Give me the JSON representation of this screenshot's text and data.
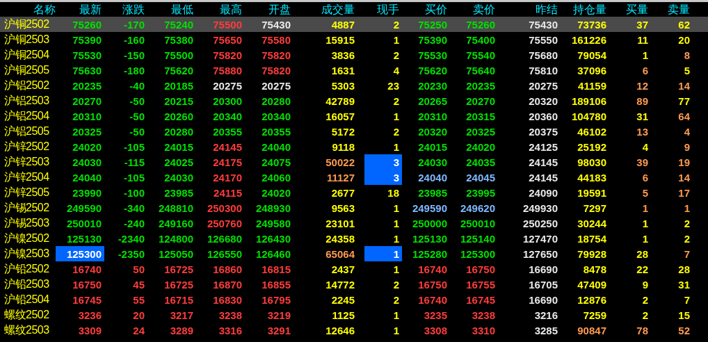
{
  "columns": [
    "名称",
    "最新",
    "涨跌",
    "最低",
    "最高",
    "开盘",
    "成交量",
    "现手",
    "买价",
    "卖价",
    "昨结",
    "持仓量",
    "买量",
    "卖量"
  ],
  "rows": [
    {
      "name": "沪铜2502",
      "selected": true,
      "cells": [
        {
          "text": "75260",
          "color": "#00e000",
          "flash": false
        },
        {
          "text": "-170",
          "color": "#00e000",
          "flash": false
        },
        {
          "text": "75240",
          "color": "#00e000",
          "flash": false
        },
        {
          "text": "75500",
          "color": "#ff3c3c",
          "flash": false
        },
        {
          "text": "75430",
          "color": "#e8e8e8",
          "flash": false
        },
        {
          "text": "4887",
          "color": "#ffff00",
          "flash": false
        },
        {
          "text": "2",
          "color": "#ffff00",
          "flash": false
        },
        {
          "text": "75250",
          "color": "#00e000",
          "flash": false
        },
        {
          "text": "75260",
          "color": "#00e000",
          "flash": false
        },
        {
          "text": "75430",
          "color": "#e8e8e8",
          "flash": false
        },
        {
          "text": "73736",
          "color": "#ffff00",
          "flash": false
        },
        {
          "text": "37",
          "color": "#ffff00",
          "flash": false
        },
        {
          "text": "62",
          "color": "#ffff00",
          "flash": false
        }
      ]
    },
    {
      "name": "沪铜2503",
      "selected": false,
      "cells": [
        {
          "text": "75390",
          "color": "#00e000",
          "flash": false
        },
        {
          "text": "-160",
          "color": "#00e000",
          "flash": false
        },
        {
          "text": "75380",
          "color": "#00e000",
          "flash": false
        },
        {
          "text": "75650",
          "color": "#ff3c3c",
          "flash": false
        },
        {
          "text": "75580",
          "color": "#ff3c3c",
          "flash": false
        },
        {
          "text": "15915",
          "color": "#ffff00",
          "flash": false
        },
        {
          "text": "1",
          "color": "#ffff00",
          "flash": false
        },
        {
          "text": "75390",
          "color": "#00e000",
          "flash": false
        },
        {
          "text": "75400",
          "color": "#00e000",
          "flash": false
        },
        {
          "text": "75550",
          "color": "#e8e8e8",
          "flash": false
        },
        {
          "text": "161226",
          "color": "#ffff00",
          "flash": false
        },
        {
          "text": "11",
          "color": "#ffff00",
          "flash": false
        },
        {
          "text": "20",
          "color": "#ffff00",
          "flash": false
        }
      ]
    },
    {
      "name": "沪铜2504",
      "selected": false,
      "cells": [
        {
          "text": "75530",
          "color": "#00e000",
          "flash": false
        },
        {
          "text": "-150",
          "color": "#00e000",
          "flash": false
        },
        {
          "text": "75500",
          "color": "#00e000",
          "flash": false
        },
        {
          "text": "75820",
          "color": "#ff3c3c",
          "flash": false
        },
        {
          "text": "75820",
          "color": "#ff3c3c",
          "flash": false
        },
        {
          "text": "3836",
          "color": "#ffff00",
          "flash": false
        },
        {
          "text": "2",
          "color": "#ffff00",
          "flash": false
        },
        {
          "text": "75530",
          "color": "#00e000",
          "flash": false
        },
        {
          "text": "75540",
          "color": "#00e000",
          "flash": false
        },
        {
          "text": "75680",
          "color": "#e8e8e8",
          "flash": false
        },
        {
          "text": "79054",
          "color": "#ffff00",
          "flash": false
        },
        {
          "text": "1",
          "color": "#ffff00",
          "flash": false
        },
        {
          "text": "8",
          "color": "#ff9a50",
          "flash": false
        }
      ]
    },
    {
      "name": "沪铜2505",
      "selected": false,
      "cells": [
        {
          "text": "75630",
          "color": "#00e000",
          "flash": false
        },
        {
          "text": "-180",
          "color": "#00e000",
          "flash": false
        },
        {
          "text": "75620",
          "color": "#00e000",
          "flash": false
        },
        {
          "text": "75880",
          "color": "#ff3c3c",
          "flash": false
        },
        {
          "text": "75820",
          "color": "#ff3c3c",
          "flash": false
        },
        {
          "text": "1631",
          "color": "#ffff00",
          "flash": false
        },
        {
          "text": "4",
          "color": "#ffff00",
          "flash": false
        },
        {
          "text": "75620",
          "color": "#00e000",
          "flash": false
        },
        {
          "text": "75640",
          "color": "#00e000",
          "flash": false
        },
        {
          "text": "75810",
          "color": "#e8e8e8",
          "flash": false
        },
        {
          "text": "37096",
          "color": "#ffff00",
          "flash": false
        },
        {
          "text": "6",
          "color": "#ff9a50",
          "flash": false
        },
        {
          "text": "5",
          "color": "#ffff00",
          "flash": false
        }
      ]
    },
    {
      "name": "沪铝2502",
      "selected": false,
      "cells": [
        {
          "text": "20235",
          "color": "#00e000",
          "flash": false
        },
        {
          "text": "-40",
          "color": "#00e000",
          "flash": false
        },
        {
          "text": "20185",
          "color": "#00e000",
          "flash": false
        },
        {
          "text": "20275",
          "color": "#e8e8e8",
          "flash": false
        },
        {
          "text": "20275",
          "color": "#e8e8e8",
          "flash": false
        },
        {
          "text": "5303",
          "color": "#ffff00",
          "flash": false
        },
        {
          "text": "23",
          "color": "#ffff00",
          "flash": false
        },
        {
          "text": "20230",
          "color": "#00e000",
          "flash": false
        },
        {
          "text": "20235",
          "color": "#00e000",
          "flash": false
        },
        {
          "text": "20275",
          "color": "#e8e8e8",
          "flash": false
        },
        {
          "text": "41159",
          "color": "#ffff00",
          "flash": false
        },
        {
          "text": "12",
          "color": "#ff9a50",
          "flash": false
        },
        {
          "text": "14",
          "color": "#ff9a50",
          "flash": false
        }
      ]
    },
    {
      "name": "沪铝2503",
      "selected": false,
      "cells": [
        {
          "text": "20270",
          "color": "#00e000",
          "flash": false
        },
        {
          "text": "-50",
          "color": "#00e000",
          "flash": false
        },
        {
          "text": "20215",
          "color": "#00e000",
          "flash": false
        },
        {
          "text": "20300",
          "color": "#00e000",
          "flash": false
        },
        {
          "text": "20280",
          "color": "#00e000",
          "flash": false
        },
        {
          "text": "42789",
          "color": "#ffff00",
          "flash": false
        },
        {
          "text": "2",
          "color": "#ffff00",
          "flash": false
        },
        {
          "text": "20265",
          "color": "#00e000",
          "flash": false
        },
        {
          "text": "20270",
          "color": "#00e000",
          "flash": false
        },
        {
          "text": "20320",
          "color": "#e8e8e8",
          "flash": false
        },
        {
          "text": "189106",
          "color": "#ffff00",
          "flash": false
        },
        {
          "text": "89",
          "color": "#ff9a50",
          "flash": false
        },
        {
          "text": "77",
          "color": "#ffff00",
          "flash": false
        }
      ]
    },
    {
      "name": "沪铝2504",
      "selected": false,
      "cells": [
        {
          "text": "20310",
          "color": "#00e000",
          "flash": false
        },
        {
          "text": "-50",
          "color": "#00e000",
          "flash": false
        },
        {
          "text": "20260",
          "color": "#00e000",
          "flash": false
        },
        {
          "text": "20340",
          "color": "#00e000",
          "flash": false
        },
        {
          "text": "20340",
          "color": "#00e000",
          "flash": false
        },
        {
          "text": "16057",
          "color": "#ffff00",
          "flash": false
        },
        {
          "text": "1",
          "color": "#ffff00",
          "flash": false
        },
        {
          "text": "20310",
          "color": "#00e000",
          "flash": false
        },
        {
          "text": "20315",
          "color": "#00e000",
          "flash": false
        },
        {
          "text": "20360",
          "color": "#e8e8e8",
          "flash": false
        },
        {
          "text": "104780",
          "color": "#ffff00",
          "flash": false
        },
        {
          "text": "31",
          "color": "#ffff00",
          "flash": false
        },
        {
          "text": "64",
          "color": "#ff9a50",
          "flash": false
        }
      ]
    },
    {
      "name": "沪铝2505",
      "selected": false,
      "cells": [
        {
          "text": "20325",
          "color": "#00e000",
          "flash": false
        },
        {
          "text": "-50",
          "color": "#00e000",
          "flash": false
        },
        {
          "text": "20280",
          "color": "#00e000",
          "flash": false
        },
        {
          "text": "20355",
          "color": "#00e000",
          "flash": false
        },
        {
          "text": "20355",
          "color": "#00e000",
          "flash": false
        },
        {
          "text": "5172",
          "color": "#ffff00",
          "flash": false
        },
        {
          "text": "2",
          "color": "#ffff00",
          "flash": false
        },
        {
          "text": "20320",
          "color": "#00e000",
          "flash": false
        },
        {
          "text": "20325",
          "color": "#00e000",
          "flash": false
        },
        {
          "text": "20375",
          "color": "#e8e8e8",
          "flash": false
        },
        {
          "text": "46102",
          "color": "#ffff00",
          "flash": false
        },
        {
          "text": "13",
          "color": "#ff9a50",
          "flash": false
        },
        {
          "text": "4",
          "color": "#ff9a50",
          "flash": false
        }
      ]
    },
    {
      "name": "沪锌2502",
      "selected": false,
      "cells": [
        {
          "text": "24020",
          "color": "#00e000",
          "flash": false
        },
        {
          "text": "-105",
          "color": "#00e000",
          "flash": false
        },
        {
          "text": "24015",
          "color": "#00e000",
          "flash": false
        },
        {
          "text": "24145",
          "color": "#ff3c3c",
          "flash": false
        },
        {
          "text": "24040",
          "color": "#00e000",
          "flash": false
        },
        {
          "text": "9118",
          "color": "#ffff00",
          "flash": false
        },
        {
          "text": "1",
          "color": "#ffff00",
          "flash": false
        },
        {
          "text": "24015",
          "color": "#00e000",
          "flash": false
        },
        {
          "text": "24020",
          "color": "#00e000",
          "flash": false
        },
        {
          "text": "24125",
          "color": "#e8e8e8",
          "flash": false
        },
        {
          "text": "25192",
          "color": "#ffff00",
          "flash": false
        },
        {
          "text": "4",
          "color": "#ffff00",
          "flash": false
        },
        {
          "text": "9",
          "color": "#ff9a50",
          "flash": false
        }
      ]
    },
    {
      "name": "沪锌2503",
      "selected": false,
      "cells": [
        {
          "text": "24030",
          "color": "#00e000",
          "flash": false
        },
        {
          "text": "-115",
          "color": "#00e000",
          "flash": false
        },
        {
          "text": "24025",
          "color": "#00e000",
          "flash": false
        },
        {
          "text": "24175",
          "color": "#ff3c3c",
          "flash": false
        },
        {
          "text": "24075",
          "color": "#00e000",
          "flash": false
        },
        {
          "text": "50022",
          "color": "#ff9a50",
          "flash": false
        },
        {
          "text": "3",
          "color": "#ffffff",
          "flash": true
        },
        {
          "text": "24030",
          "color": "#00e000",
          "flash": false
        },
        {
          "text": "24035",
          "color": "#00e000",
          "flash": false
        },
        {
          "text": "24145",
          "color": "#e8e8e8",
          "flash": false
        },
        {
          "text": "98030",
          "color": "#ffff00",
          "flash": false
        },
        {
          "text": "39",
          "color": "#ff9a50",
          "flash": false
        },
        {
          "text": "19",
          "color": "#ff9a50",
          "flash": false
        }
      ]
    },
    {
      "name": "沪锌2504",
      "selected": false,
      "cells": [
        {
          "text": "24040",
          "color": "#00e000",
          "flash": false
        },
        {
          "text": "-105",
          "color": "#00e000",
          "flash": false
        },
        {
          "text": "24030",
          "color": "#00e000",
          "flash": false
        },
        {
          "text": "24170",
          "color": "#ff3c3c",
          "flash": false
        },
        {
          "text": "24060",
          "color": "#00e000",
          "flash": false
        },
        {
          "text": "11127",
          "color": "#ff9a50",
          "flash": false
        },
        {
          "text": "3",
          "color": "#ffffff",
          "flash": true
        },
        {
          "text": "24040",
          "color": "#80b8ff",
          "flash": false
        },
        {
          "text": "24045",
          "color": "#80b8ff",
          "flash": false
        },
        {
          "text": "24145",
          "color": "#e8e8e8",
          "flash": false
        },
        {
          "text": "44183",
          "color": "#ffff00",
          "flash": false
        },
        {
          "text": "6",
          "color": "#ff9a50",
          "flash": false
        },
        {
          "text": "14",
          "color": "#ff9a50",
          "flash": false
        }
      ]
    },
    {
      "name": "沪锌2505",
      "selected": false,
      "cells": [
        {
          "text": "23990",
          "color": "#00e000",
          "flash": false
        },
        {
          "text": "-100",
          "color": "#00e000",
          "flash": false
        },
        {
          "text": "23985",
          "color": "#00e000",
          "flash": false
        },
        {
          "text": "24115",
          "color": "#ff3c3c",
          "flash": false
        },
        {
          "text": "24020",
          "color": "#00e000",
          "flash": false
        },
        {
          "text": "2677",
          "color": "#ffff00",
          "flash": false
        },
        {
          "text": "18",
          "color": "#ffff00",
          "flash": false
        },
        {
          "text": "23985",
          "color": "#00e000",
          "flash": false
        },
        {
          "text": "23995",
          "color": "#00e000",
          "flash": false
        },
        {
          "text": "24090",
          "color": "#e8e8e8",
          "flash": false
        },
        {
          "text": "19591",
          "color": "#ffff00",
          "flash": false
        },
        {
          "text": "5",
          "color": "#ff9a50",
          "flash": false
        },
        {
          "text": "17",
          "color": "#ff9a50",
          "flash": false
        }
      ]
    },
    {
      "name": "沪锡2502",
      "selected": false,
      "cells": [
        {
          "text": "249590",
          "color": "#00e000",
          "flash": false
        },
        {
          "text": "-340",
          "color": "#00e000",
          "flash": false
        },
        {
          "text": "248810",
          "color": "#00e000",
          "flash": false
        },
        {
          "text": "250300",
          "color": "#ff3c3c",
          "flash": false
        },
        {
          "text": "248930",
          "color": "#00e000",
          "flash": false
        },
        {
          "text": "9563",
          "color": "#ffff00",
          "flash": false
        },
        {
          "text": "1",
          "color": "#ffff00",
          "flash": false
        },
        {
          "text": "249590",
          "color": "#80b8ff",
          "flash": false
        },
        {
          "text": "249620",
          "color": "#80b8ff",
          "flash": false
        },
        {
          "text": "249930",
          "color": "#e8e8e8",
          "flash": false
        },
        {
          "text": "7297",
          "color": "#ffff00",
          "flash": false
        },
        {
          "text": "1",
          "color": "#ff9a50",
          "flash": false
        },
        {
          "text": "1",
          "color": "#ff9a50",
          "flash": false
        }
      ]
    },
    {
      "name": "沪锡2503",
      "selected": false,
      "cells": [
        {
          "text": "250010",
          "color": "#00e000",
          "flash": false
        },
        {
          "text": "-240",
          "color": "#00e000",
          "flash": false
        },
        {
          "text": "249160",
          "color": "#00e000",
          "flash": false
        },
        {
          "text": "250760",
          "color": "#ff3c3c",
          "flash": false
        },
        {
          "text": "249580",
          "color": "#00e000",
          "flash": false
        },
        {
          "text": "23101",
          "color": "#ffff00",
          "flash": false
        },
        {
          "text": "1",
          "color": "#ffff00",
          "flash": false
        },
        {
          "text": "250000",
          "color": "#00e000",
          "flash": false
        },
        {
          "text": "250010",
          "color": "#00e000",
          "flash": false
        },
        {
          "text": "250250",
          "color": "#e8e8e8",
          "flash": false
        },
        {
          "text": "30244",
          "color": "#ffff00",
          "flash": false
        },
        {
          "text": "1",
          "color": "#ffff00",
          "flash": false
        },
        {
          "text": "2",
          "color": "#ffff00",
          "flash": false
        }
      ]
    },
    {
      "name": "沪镍2502",
      "selected": false,
      "cells": [
        {
          "text": "125130",
          "color": "#00e000",
          "flash": false
        },
        {
          "text": "-2340",
          "color": "#00e000",
          "flash": false
        },
        {
          "text": "124800",
          "color": "#00e000",
          "flash": false
        },
        {
          "text": "126680",
          "color": "#00e000",
          "flash": false
        },
        {
          "text": "126430",
          "color": "#00e000",
          "flash": false
        },
        {
          "text": "24358",
          "color": "#ffff00",
          "flash": false
        },
        {
          "text": "1",
          "color": "#ffff00",
          "flash": false
        },
        {
          "text": "125130",
          "color": "#00e000",
          "flash": false
        },
        {
          "text": "125140",
          "color": "#00e000",
          "flash": false
        },
        {
          "text": "127470",
          "color": "#e8e8e8",
          "flash": false
        },
        {
          "text": "18754",
          "color": "#ffff00",
          "flash": false
        },
        {
          "text": "1",
          "color": "#ffff00",
          "flash": false
        },
        {
          "text": "2",
          "color": "#ffff00",
          "flash": false
        }
      ]
    },
    {
      "name": "沪镍2503",
      "selected": false,
      "cells": [
        {
          "text": "125300",
          "color": "#ffffff",
          "flash": true
        },
        {
          "text": "-2350",
          "color": "#00e000",
          "flash": false
        },
        {
          "text": "125050",
          "color": "#00e000",
          "flash": false
        },
        {
          "text": "126550",
          "color": "#00e000",
          "flash": false
        },
        {
          "text": "126460",
          "color": "#00e000",
          "flash": false
        },
        {
          "text": "65064",
          "color": "#ff9a50",
          "flash": false
        },
        {
          "text": "1",
          "color": "#ffffff",
          "flash": true
        },
        {
          "text": "125280",
          "color": "#00e000",
          "flash": false
        },
        {
          "text": "125300",
          "color": "#00e000",
          "flash": false
        },
        {
          "text": "127650",
          "color": "#e8e8e8",
          "flash": false
        },
        {
          "text": "79928",
          "color": "#ffff00",
          "flash": false
        },
        {
          "text": "28",
          "color": "#ffff00",
          "flash": false
        },
        {
          "text": "7",
          "color": "#ff9a50",
          "flash": false
        }
      ]
    },
    {
      "name": "沪铅2502",
      "selected": false,
      "cells": [
        {
          "text": "16740",
          "color": "#ff3c3c",
          "flash": false
        },
        {
          "text": "50",
          "color": "#ff3c3c",
          "flash": false
        },
        {
          "text": "16725",
          "color": "#ff3c3c",
          "flash": false
        },
        {
          "text": "16860",
          "color": "#ff3c3c",
          "flash": false
        },
        {
          "text": "16815",
          "color": "#ff3c3c",
          "flash": false
        },
        {
          "text": "2437",
          "color": "#ffff00",
          "flash": false
        },
        {
          "text": "1",
          "color": "#ffff00",
          "flash": false
        },
        {
          "text": "16740",
          "color": "#ff3c3c",
          "flash": false
        },
        {
          "text": "16750",
          "color": "#ff3c3c",
          "flash": false
        },
        {
          "text": "16690",
          "color": "#e8e8e8",
          "flash": false
        },
        {
          "text": "8478",
          "color": "#ffff00",
          "flash": false
        },
        {
          "text": "22",
          "color": "#ffff00",
          "flash": false
        },
        {
          "text": "28",
          "color": "#ffff00",
          "flash": false
        }
      ]
    },
    {
      "name": "沪铅2503",
      "selected": false,
      "cells": [
        {
          "text": "16750",
          "color": "#ff3c3c",
          "flash": false
        },
        {
          "text": "45",
          "color": "#ff3c3c",
          "flash": false
        },
        {
          "text": "16725",
          "color": "#ff3c3c",
          "flash": false
        },
        {
          "text": "16870",
          "color": "#ff3c3c",
          "flash": false
        },
        {
          "text": "16855",
          "color": "#ff3c3c",
          "flash": false
        },
        {
          "text": "14772",
          "color": "#ffff00",
          "flash": false
        },
        {
          "text": "2",
          "color": "#ffff00",
          "flash": false
        },
        {
          "text": "16750",
          "color": "#ff3c3c",
          "flash": false
        },
        {
          "text": "16755",
          "color": "#ff3c3c",
          "flash": false
        },
        {
          "text": "16705",
          "color": "#e8e8e8",
          "flash": false
        },
        {
          "text": "47409",
          "color": "#ffff00",
          "flash": false
        },
        {
          "text": "9",
          "color": "#ffff00",
          "flash": false
        },
        {
          "text": "31",
          "color": "#ffff00",
          "flash": false
        }
      ]
    },
    {
      "name": "沪铅2504",
      "selected": false,
      "cells": [
        {
          "text": "16745",
          "color": "#ff3c3c",
          "flash": false
        },
        {
          "text": "55",
          "color": "#ff3c3c",
          "flash": false
        },
        {
          "text": "16715",
          "color": "#ff3c3c",
          "flash": false
        },
        {
          "text": "16830",
          "color": "#ff3c3c",
          "flash": false
        },
        {
          "text": "16795",
          "color": "#ff3c3c",
          "flash": false
        },
        {
          "text": "2245",
          "color": "#ffff00",
          "flash": false
        },
        {
          "text": "2",
          "color": "#ffff00",
          "flash": false
        },
        {
          "text": "16740",
          "color": "#ff3c3c",
          "flash": false
        },
        {
          "text": "16745",
          "color": "#ff3c3c",
          "flash": false
        },
        {
          "text": "16690",
          "color": "#e8e8e8",
          "flash": false
        },
        {
          "text": "12876",
          "color": "#ffff00",
          "flash": false
        },
        {
          "text": "2",
          "color": "#ffff00",
          "flash": false
        },
        {
          "text": "7",
          "color": "#ffff00",
          "flash": false
        }
      ]
    },
    {
      "name": "螺纹2502",
      "selected": false,
      "cells": [
        {
          "text": "3236",
          "color": "#ff3c3c",
          "flash": false
        },
        {
          "text": "20",
          "color": "#ff3c3c",
          "flash": false
        },
        {
          "text": "3217",
          "color": "#ff3c3c",
          "flash": false
        },
        {
          "text": "3238",
          "color": "#ff3c3c",
          "flash": false
        },
        {
          "text": "3219",
          "color": "#ff3c3c",
          "flash": false
        },
        {
          "text": "1125",
          "color": "#ffff00",
          "flash": false
        },
        {
          "text": "1",
          "color": "#ffff00",
          "flash": false
        },
        {
          "text": "3235",
          "color": "#ff3c3c",
          "flash": false
        },
        {
          "text": "3238",
          "color": "#ff3c3c",
          "flash": false
        },
        {
          "text": "3216",
          "color": "#e8e8e8",
          "flash": false
        },
        {
          "text": "7259",
          "color": "#ffff00",
          "flash": false
        },
        {
          "text": "2",
          "color": "#ffff00",
          "flash": false
        },
        {
          "text": "15",
          "color": "#ffff00",
          "flash": false
        }
      ]
    },
    {
      "name": "螺纹2503",
      "selected": false,
      "cells": [
        {
          "text": "3309",
          "color": "#ff3c3c",
          "flash": false
        },
        {
          "text": "24",
          "color": "#ff3c3c",
          "flash": false
        },
        {
          "text": "3289",
          "color": "#ff3c3c",
          "flash": false
        },
        {
          "text": "3316",
          "color": "#ff3c3c",
          "flash": false
        },
        {
          "text": "3291",
          "color": "#ff3c3c",
          "flash": false
        },
        {
          "text": "12646",
          "color": "#ffff00",
          "flash": false
        },
        {
          "text": "1",
          "color": "#ffff00",
          "flash": false
        },
        {
          "text": "3308",
          "color": "#ff3c3c",
          "flash": false
        },
        {
          "text": "3310",
          "color": "#ff3c3c",
          "flash": false
        },
        {
          "text": "3285",
          "color": "#e8e8e8",
          "flash": false
        },
        {
          "text": "90847",
          "color": "#ff9a50",
          "flash": false
        },
        {
          "text": "78",
          "color": "#ff9a50",
          "flash": false
        },
        {
          "text": "52",
          "color": "#ff9a50",
          "flash": false
        }
      ]
    }
  ]
}
